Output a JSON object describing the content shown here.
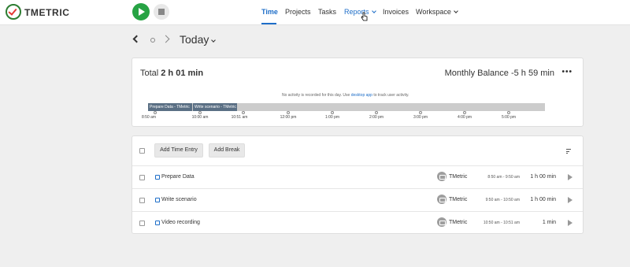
{
  "header": {
    "brand": "TMETRIC",
    "nav": [
      "Time",
      "Projects",
      "Tasks",
      "Reports",
      "Invoices",
      "Workspace"
    ],
    "active_nav": "Time"
  },
  "date_nav": {
    "label": "Today"
  },
  "summary": {
    "total_label": "Total",
    "total_value": "2 h 01 min",
    "balance_label": "Monthly Balance",
    "balance_value": "-5 h 59 min",
    "more_label": "•••",
    "note_prefix": "No activity is recorded for this day. Use",
    "note_link": "desktop app",
    "note_suffix": "to track user activity.",
    "segments": [
      "Prepare Data - TMetric",
      "Write scenario - TMetric"
    ],
    "ticks": [
      "8:50 am",
      "10:00 am",
      "10:51 am",
      "12:00 pm",
      "1:00 pm",
      "2:00 pm",
      "3:00 pm",
      "4:00 pm",
      "5:00 pm"
    ]
  },
  "entries_toolbar": {
    "add_time_entry": "Add Time Entry",
    "add_break": "Add Break"
  },
  "entries": [
    {
      "task": "Prepare Data",
      "project": "TMetric",
      "range": "8:50 am - 9:50 am",
      "duration": "1 h 00 min"
    },
    {
      "task": "Write scenario",
      "project": "TMetric",
      "range": "9:50 am - 10:50 am",
      "duration": "1 h 00 min"
    },
    {
      "task": "Video recording",
      "project": "TMetric",
      "range": "10:50 am - 10:51 am",
      "duration": "1 min"
    }
  ],
  "colors": {
    "accent": "#1e6ec8",
    "play": "#27a344",
    "timeline_segment": "#5a6f84"
  }
}
